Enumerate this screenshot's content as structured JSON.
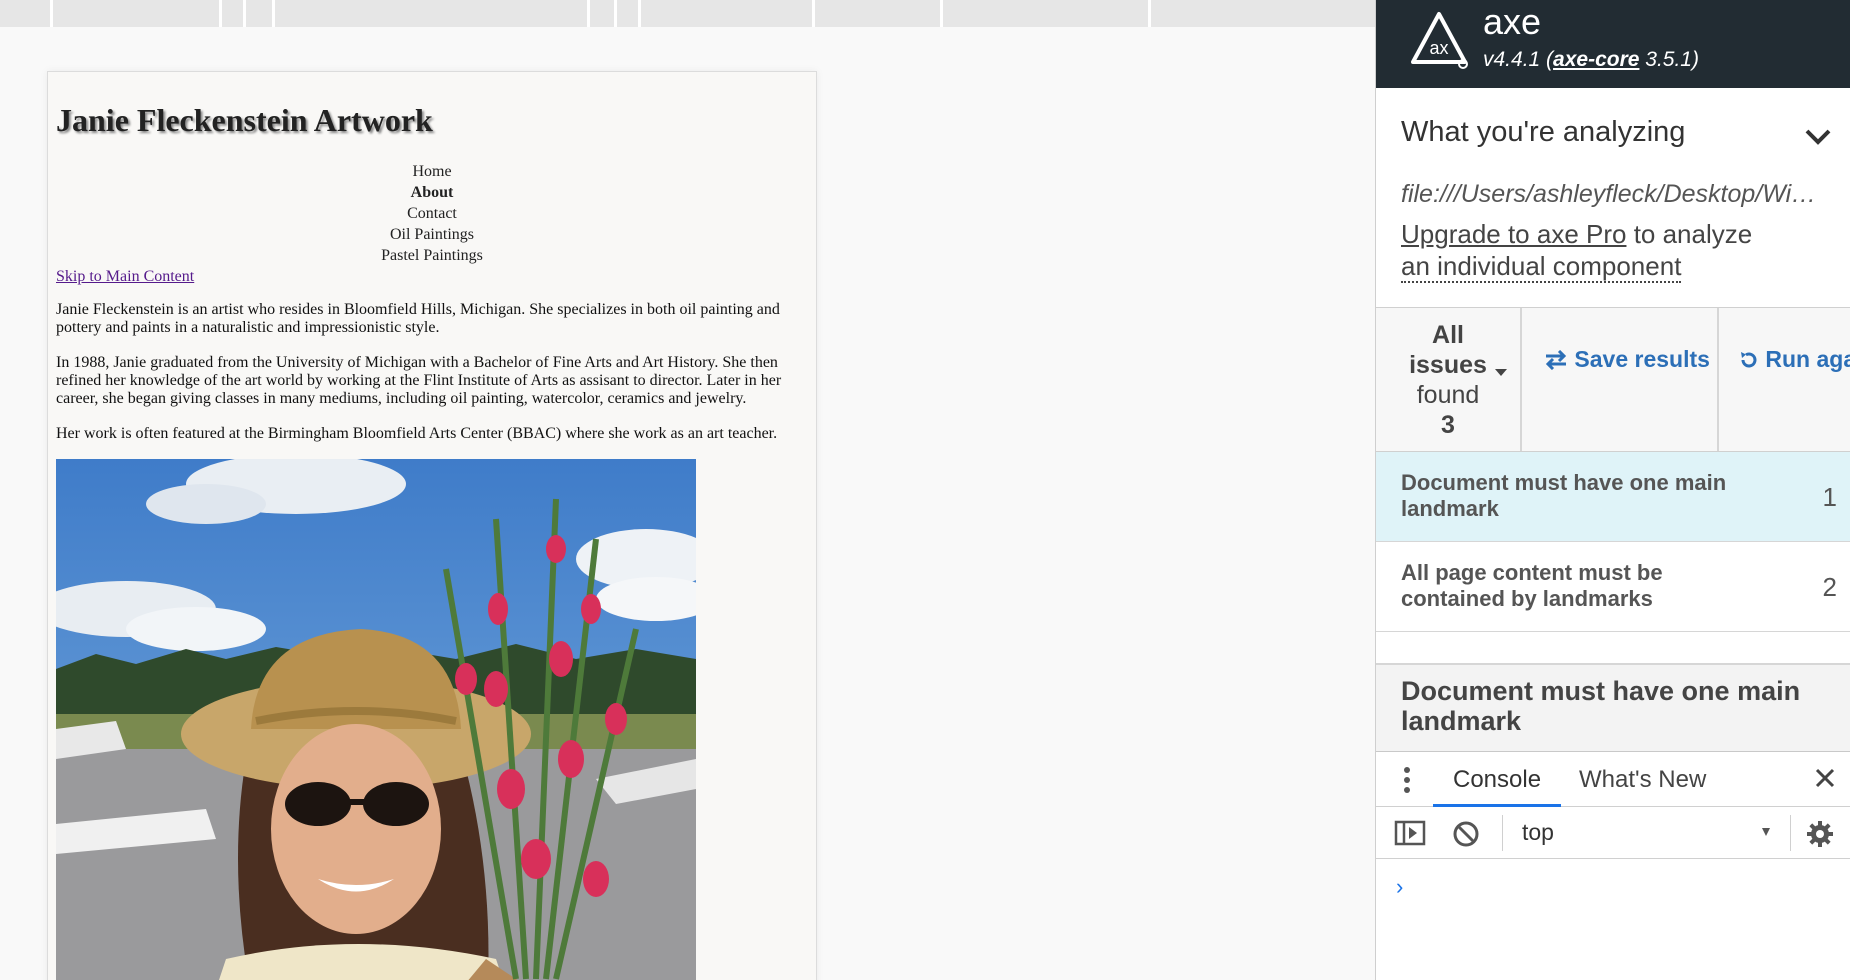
{
  "site": {
    "title": "Janie Fleckenstein Artwork",
    "nav": [
      "Home",
      "About",
      "Contact",
      "Oil Paintings",
      "Pastel Paintings"
    ],
    "current_nav": "About",
    "skip_link": "Skip to Main Content",
    "paragraphs": [
      "Janie Fleckenstein is an artist who resides in Bloomfield Hills, Michigan. She specializes in both oil painting and pottery and paints in a naturalistic and impressionistic style.",
      "In 1988, Janie graduated from the University of Michigan with a Bachelor of Fine Arts and Art History. She then refined her knowledge of the art world by working at the Flint Institute of Arts as assisant to director. Later in her career, she began giving classes in many mediums, including oil painting, watercolor, ceramics and jewelry.",
      "Her work is often featured at the Birmingham Bloomfield Arts Center (BBAC) where she work as an art teacher."
    ]
  },
  "axe": {
    "name": "axe",
    "version": "v4.4.1",
    "core_label": "axe-core",
    "core_version": "3.5.1",
    "analyzing_title": "What you're analyzing",
    "analyzing_url": "file:///Users/ashleyfleck/Desktop/Wi…",
    "upgrade_link": "Upgrade to axe Pro",
    "upgrade_rest": " to analyze",
    "upgrade_line2": "an individual component",
    "issues_line1": "All",
    "issues_line2": "issues",
    "issues_line3": "found",
    "issues_count": "3",
    "save_label": "Save results",
    "run_label": "Run aga",
    "issues": [
      {
        "label": "Document must have one main landmark",
        "count": "1"
      },
      {
        "label": "All page content must be contained by landmarks",
        "count": "2"
      }
    ],
    "detail_title": "Document must have one main landmark"
  },
  "drawer": {
    "tabs": [
      "Console",
      "What's New"
    ],
    "context": "top",
    "prompt": "›"
  },
  "colors": {
    "axe_header": "#222c33",
    "axe_link": "#2c6fb7",
    "active_row": "#dff3f8",
    "devtools_accent": "#1a73e8"
  }
}
